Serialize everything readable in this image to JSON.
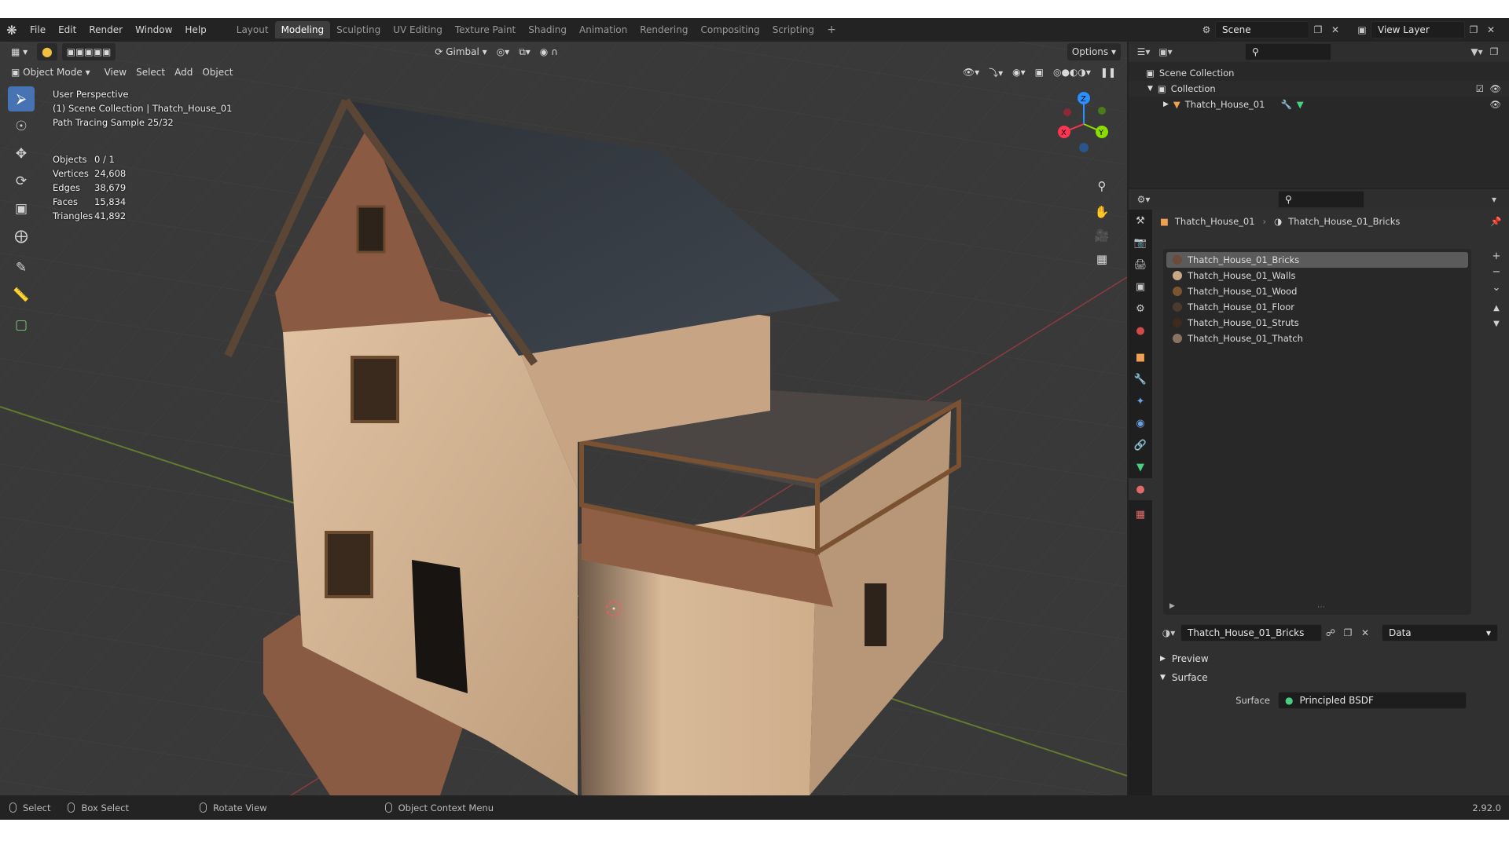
{
  "topbar": {
    "menus": [
      "File",
      "Edit",
      "Render",
      "Window",
      "Help"
    ],
    "workspaces": [
      "Layout",
      "Modeling",
      "Sculpting",
      "UV Editing",
      "Texture Paint",
      "Shading",
      "Animation",
      "Rendering",
      "Compositing",
      "Scripting"
    ],
    "active_workspace": "Modeling",
    "scene": "Scene",
    "view_layer": "View Layer"
  },
  "viewport": {
    "mode": "Object Mode",
    "menus": [
      "View",
      "Select",
      "Add",
      "Object"
    ],
    "orientation": "Gimbal",
    "options_label": "Options",
    "perspective": "User Perspective",
    "collection_info": "(1) Scene Collection | Thatch_House_01",
    "render_sample": "Path Tracing Sample 25/32",
    "stats": [
      {
        "label": "Objects",
        "value": "0 / 1"
      },
      {
        "label": "Vertices",
        "value": "24,608"
      },
      {
        "label": "Edges",
        "value": "38,679"
      },
      {
        "label": "Faces",
        "value": "15,834"
      },
      {
        "label": "Triangles",
        "value": "41,892"
      }
    ],
    "gizmo_axes": [
      "Z",
      "X",
      "Y"
    ]
  },
  "outliner": {
    "root": "Scene Collection",
    "collection": "Collection",
    "object": "Thatch_House_01"
  },
  "properties": {
    "object_name": "Thatch_House_01",
    "material_name": "Thatch_House_01_Bricks",
    "materials": [
      {
        "name": "Thatch_House_01_Bricks",
        "color": "#6b4a3a"
      },
      {
        "name": "Thatch_House_01_Walls",
        "color": "#c8a887"
      },
      {
        "name": "Thatch_House_01_Wood",
        "color": "#7a5530"
      },
      {
        "name": "Thatch_House_01_Floor",
        "color": "#4a3a30"
      },
      {
        "name": "Thatch_House_01_Struts",
        "color": "#3e2b1c"
      },
      {
        "name": "Thatch_House_01_Thatch",
        "color": "#8a7460"
      }
    ],
    "selected_material": "Thatch_House_01_Bricks",
    "slot_link": "Data",
    "panels": [
      "Preview",
      "Surface"
    ],
    "surface_label": "Surface",
    "surface_shader": "Principled BSDF"
  },
  "statusbar": {
    "items": [
      "Select",
      "Box Select",
      "Rotate View",
      "Object Context Menu"
    ],
    "version": "2.92.0"
  },
  "colors": {
    "accent": "#4772b3",
    "x_axis": "#ff3352",
    "y_axis": "#8bdc00",
    "z_axis": "#2890ff"
  }
}
